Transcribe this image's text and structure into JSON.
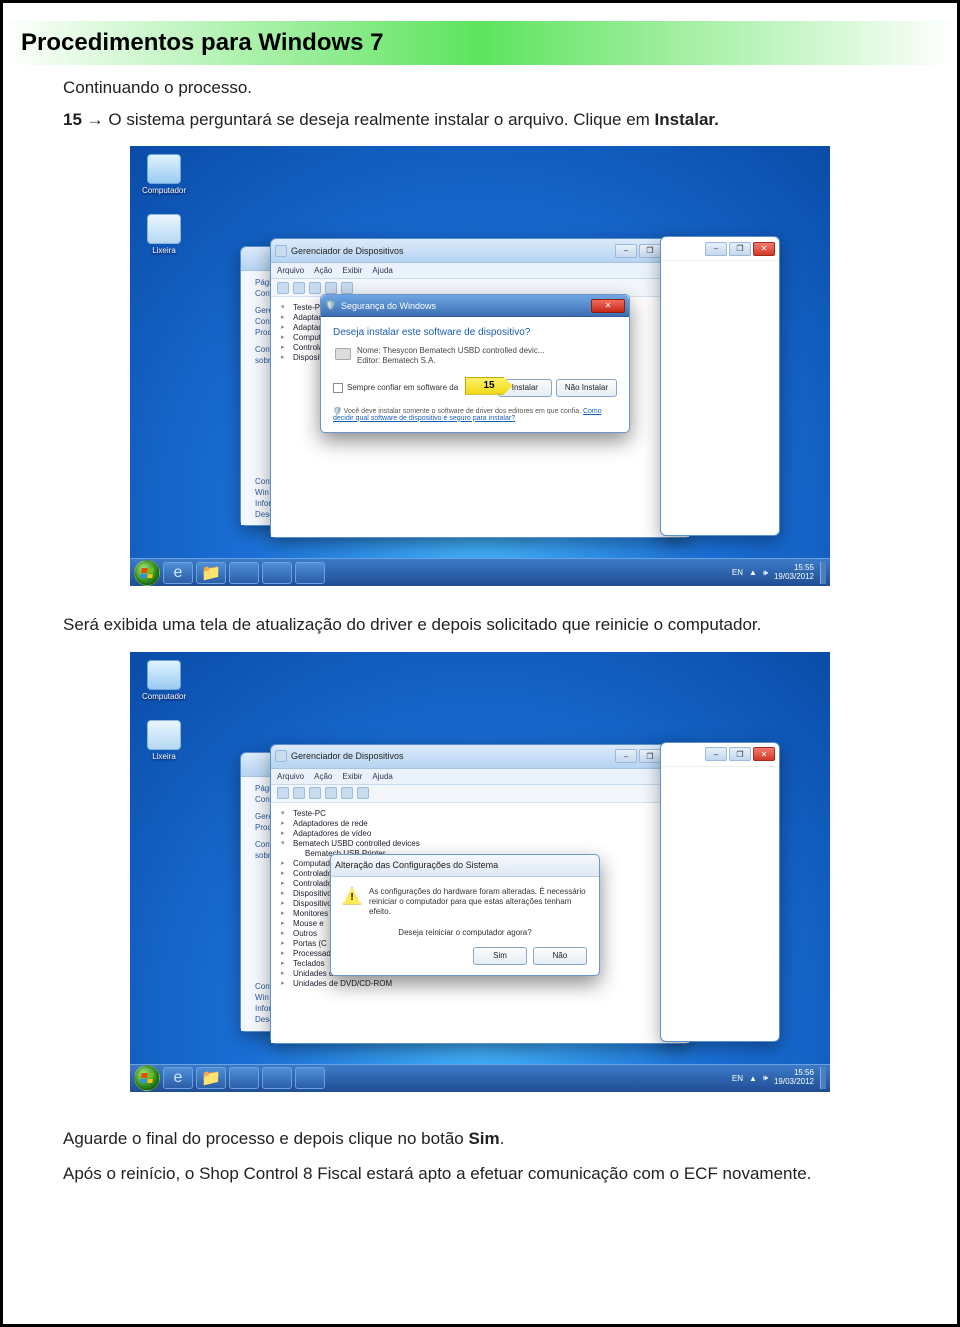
{
  "page": {
    "title": "Procedimentos para Windows 7",
    "intro": "Continuando o processo.",
    "step15_prefix": "15",
    "step15_arrow": " → ",
    "step15_text": "O sistema perguntará se deseja realmente instalar o arquivo. Clique em ",
    "step15_bold": "Instalar.",
    "mid_text": "Será exibida uma tela de atualização do driver e depois solicitado que reinicie o computador.",
    "end_text_1": "Aguarde o final do processo e depois clique no botão ",
    "end_text_1_bold": "Sim",
    "end_text_1_suffix": ".",
    "end_text_2": "Após o reinício, o Shop Control 8 Fiscal estará apto a efetuar comunicação com o ECF novamente."
  },
  "desktop": {
    "icon_computer": "Computador",
    "icon_trash": "Lixeira",
    "clock1_time": "15:55",
    "clock1_date": "19/03/2012",
    "clock2_time": "15:56",
    "clock2_date": "19/03/2012",
    "lang": "EN"
  },
  "devmgr": {
    "title": "Gerenciador de Dispositivos",
    "menu": [
      "Arquivo",
      "Ação",
      "Exibir",
      "Ajuda"
    ],
    "tree_root": "Teste-PC",
    "nodes": [
      "Adaptadores de rede",
      "Adaptadores de vídeo",
      "Bematech USBD controlled devices",
      "Bematech USB Printer",
      "Computador",
      "Controladores",
      "Dispositivos",
      "Dispositivos",
      "Monitores",
      "Mouse e",
      "Outros",
      "Portas (C",
      "Processadores",
      "Teclados",
      "Unidades de disco",
      "Unidades de DVD/CD-ROM"
    ]
  },
  "sidepanel": {
    "items": [
      "Página",
      "Cont",
      "Gere",
      "Cont",
      "Proc",
      "Cont",
      "sobr"
    ],
    "items2": [
      "Cont",
      "Win",
      "Infor",
      "Dese"
    ]
  },
  "sec_dialog": {
    "win_title": "Segurança do Windows",
    "question": "Deseja instalar este software de dispositivo?",
    "line1": "Nome: Thesycon Bematech USBD controlled devic...",
    "line2": "Editor: Bematech S.A.",
    "checkbox": "Sempre confiar em software da",
    "callout": "15",
    "btn_install": "Instalar",
    "btn_no": "Não Instalar",
    "footnote": "Você deve instalar somente o software de driver dos editores em que confia. ",
    "footlink": "Como decidir qual software de dispositivo é seguro para instalar?"
  },
  "restart_dialog": {
    "win_title": "Alteração das Configurações do Sistema",
    "line1": "As configurações do hardware foram alteradas. É necessário reiniciar o computador para que estas alterações tenham efeito.",
    "line2": "Deseja reiniciar o computador agora?",
    "btn_yes": "Sim",
    "btn_no": "Não"
  }
}
